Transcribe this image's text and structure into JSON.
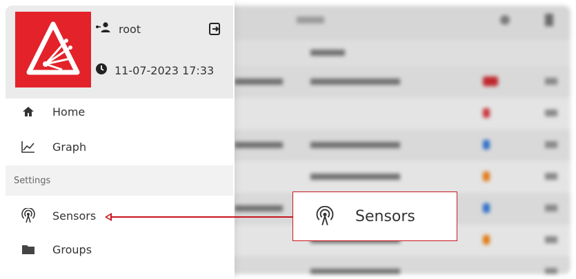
{
  "user": {
    "name": "root"
  },
  "datetime": "11-07-2023 17:33",
  "nav": {
    "home": "Home",
    "graph": "Graph",
    "settings_section": "Settings",
    "sensors": "Sensors",
    "groups": "Groups"
  },
  "callout": {
    "label": "Sensors"
  },
  "colors": {
    "brand_red": "#e3222a",
    "callout_red": "#c8141c"
  },
  "icons": {
    "user": "user-switch-icon",
    "logout": "logout-icon",
    "clock": "clock-icon",
    "home": "home-icon",
    "graph": "line-chart-icon",
    "sensors": "sensor-antenna-icon",
    "groups": "folder-icon"
  }
}
